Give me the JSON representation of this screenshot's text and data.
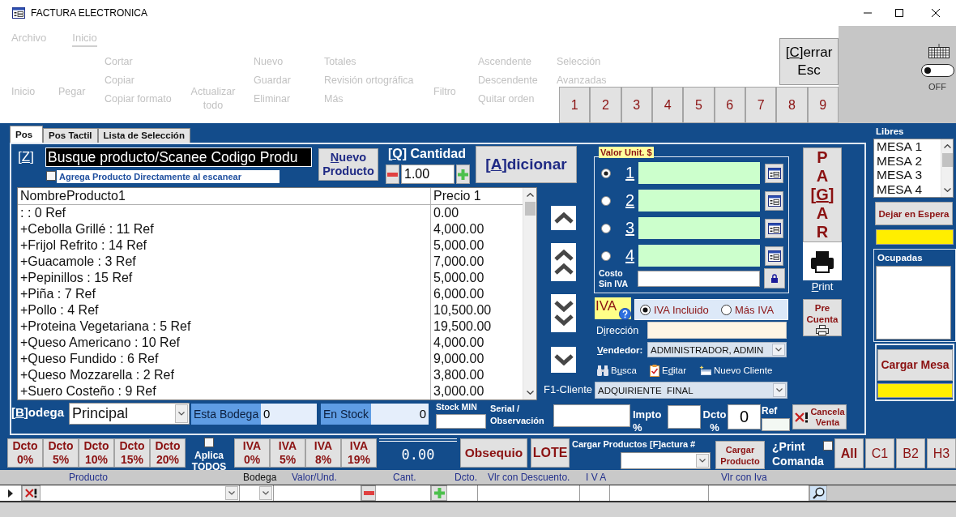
{
  "window": {
    "title": "FACTURA ELECTRONICA"
  },
  "ribbon": {
    "tabs": [
      {
        "label": "Archivo",
        "selected": false
      },
      {
        "label": "Inicio",
        "selected": true
      }
    ],
    "columns": [
      [
        "Inicio"
      ],
      [
        "Pegar"
      ],
      [
        "Cortar",
        "Copiar",
        "Copiar formato"
      ],
      [
        "Actualizar todo"
      ],
      [
        "Nuevo",
        "Guardar",
        "Eliminar"
      ],
      [
        "Totales",
        "Revisión ortográfica",
        "Más"
      ],
      [
        "Filtro"
      ],
      [
        "Ascendente",
        "Descendente",
        "Quitar orden"
      ],
      [
        "Selección",
        "Avanzadas"
      ]
    ]
  },
  "close_button": {
    "lines": [
      {
        "pre": "[",
        "key": "C",
        "post": "]errar"
      },
      "Esc"
    ]
  },
  "number_buttons": [
    "1",
    "2",
    "3",
    "4",
    "5",
    "6",
    "7",
    "8",
    "9"
  ],
  "keyboard": {
    "on": false,
    "label": "OFF"
  },
  "tabs": [
    {
      "label": "Pos",
      "selected": true
    },
    {
      "label": "Pos Tactil",
      "selected": false
    },
    {
      "label": "Lista de Selección",
      "selected": false
    }
  ],
  "search": {
    "hotkey": {
      "pre": "[",
      "key": "Z",
      "post": "]"
    },
    "value": "Busque producto/Scanee Codigo Produ"
  },
  "scan_option": {
    "label": "Agrega Producto Directamente al escanear",
    "checked": false
  },
  "new_product_button": {
    "label": {
      "key": "N",
      "post": "uevo Producto"
    }
  },
  "quantity": {
    "label": {
      "pre": "[",
      "key": "Q",
      "post": "] Cantidad"
    },
    "value": "1.00"
  },
  "add_button": {
    "label": {
      "pre": "[",
      "key": "A",
      "post": "]dicionar"
    }
  },
  "products": {
    "columns": [
      "NombreProducto1",
      "Precio 1"
    ],
    "rows": [
      {
        "name": ": : 0 Ref",
        "price": "0.00"
      },
      {
        "name": "+Cebolla Grillé : 11 Ref",
        "price": "4,000.00"
      },
      {
        "name": "+Frijol Refrito : 14 Ref",
        "price": "5,000.00"
      },
      {
        "name": "+Guacamole : 3 Ref",
        "price": "7,000.00"
      },
      {
        "name": "+Pepinillos : 15 Ref",
        "price": "5,000.00"
      },
      {
        "name": "+Piña : 7 Ref",
        "price": "6,000.00"
      },
      {
        "name": "+Pollo : 4 Ref",
        "price": "10,500.00"
      },
      {
        "name": "+Proteina Vegetariana : 5 Ref",
        "price": "19,500.00"
      },
      {
        "name": "+Queso Americano : 10 Ref",
        "price": "4,000.00"
      },
      {
        "name": "+Queso Fundido : 6 Ref",
        "price": "9,000.00"
      },
      {
        "name": "+Queso Mozzarella : 2 Ref",
        "price": "3,800.00"
      },
      {
        "name": "+Suero Costeño : 9 Ref",
        "price": "3,000.00"
      }
    ]
  },
  "unit_price": {
    "label": "Valor Unit. $",
    "options": [
      {
        "number": "1",
        "selected": true
      },
      {
        "number": "2",
        "selected": false
      },
      {
        "number": "3",
        "selected": false
      },
      {
        "number": "4",
        "selected": false
      }
    ],
    "cost_label": "Costo Sin IVA"
  },
  "pay_button": {
    "lines": [
      "P",
      "A",
      {
        "pre": "[",
        "key": "G",
        "post": "]"
      },
      "A",
      "R"
    ]
  },
  "print_button": {
    "label": {
      "key": "P",
      "post": "rint"
    }
  },
  "pre_account_button": {
    "label": "Pre Cuenta"
  },
  "tax_mode": {
    "label": "IVA",
    "options": [
      {
        "label": "IVA Incluido",
        "selected": true
      },
      {
        "label": "Más IVA",
        "selected": false
      }
    ]
  },
  "address": {
    "label": {
      "pre": "D",
      "key": "i",
      "post": "rección"
    }
  },
  "seller": {
    "label": {
      "key": "V",
      "post": "endedor:"
    },
    "value": "ADMINISTRADOR, ADMIN"
  },
  "client_actions": [
    {
      "kind": "search",
      "label": {
        "pre": "B",
        "key": "u",
        "post": "sca"
      }
    },
    {
      "kind": "edit",
      "label": {
        "pre": "E",
        "key": "d",
        "post": "itar"
      }
    },
    {
      "kind": "new",
      "label": "Nuevo Cliente"
    }
  ],
  "client": {
    "label": "F1-Cliente",
    "value": "ADQUIRIENTE  FINAL"
  },
  "warehouse": {
    "label": {
      "pre": "[",
      "key": "B",
      "post": "]odega"
    },
    "value": "Principal"
  },
  "stock": [
    {
      "label": "Esta Bodega",
      "value": "0"
    },
    {
      "label": "En Stock",
      "value": "0"
    }
  ],
  "stock_min": {
    "label": "Stock MIN"
  },
  "serial": {
    "label": "Serial / Observación"
  },
  "tax_pct": {
    "label": "Impto %"
  },
  "discount_pct": {
    "label": "Dcto %",
    "value": "0"
  },
  "ref": {
    "label": "Ref"
  },
  "cancel_button": {
    "label": "Cancela Venta"
  },
  "tables": {
    "free_title": "Libres",
    "free": [
      "MESA 1",
      "MESA 2",
      "MESA 3",
      "MESA 4"
    ],
    "hold_button": "Dejar en Espera",
    "occupied_title": "Ocupadas",
    "load_button": "Cargar Mesa"
  },
  "discount_buttons": [
    "Dcto 0%",
    "Dcto 5%",
    "Dcto 10%",
    "Dcto 15%",
    "Dcto 20%"
  ],
  "apply_all": {
    "label": "Aplica TODOS",
    "checked": false
  },
  "tax_buttons": [
    "IVA 0%",
    "IVA 5%",
    "IVA 8%",
    "IVA 19%"
  ],
  "total": "0.00",
  "gift_button": "Obsequio",
  "lot_button": "LOTE",
  "invoice_load": {
    "label": "Cargar Productos [F]actura #"
  },
  "load_product_button": "Cargar Producto",
  "print_order": {
    "label": "¿Print Comanda",
    "checked": false
  },
  "filters": [
    {
      "label": "All",
      "selected": true
    },
    {
      "label": "C1",
      "selected": false
    },
    {
      "label": "B2",
      "selected": false
    },
    {
      "label": "H3",
      "selected": false
    }
  ],
  "grid": {
    "columns": [
      "Producto",
      "Bodega",
      "Valor/Und.",
      "Cant.",
      "Dcto.",
      "Vlr con Descuento.",
      "I V A",
      "Vlr con Iva"
    ]
  }
}
